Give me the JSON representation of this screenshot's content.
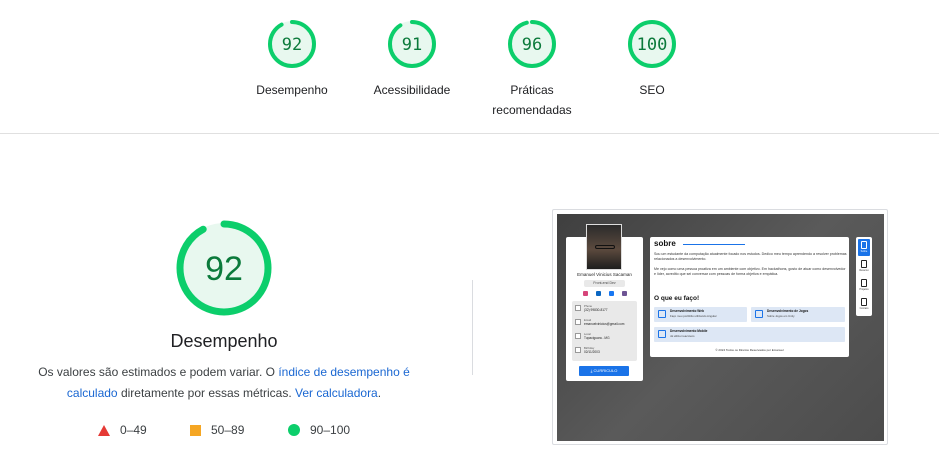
{
  "top_scores": [
    {
      "score": "92",
      "label_line1": "Desempenho",
      "label_line2": ""
    },
    {
      "score": "91",
      "label_line1": "Acessibilidade",
      "label_line2": ""
    },
    {
      "score": "96",
      "label_line1": "Práticas",
      "label_line2": "recomendadas"
    },
    {
      "score": "100",
      "label_line1": "SEO",
      "label_line2": ""
    }
  ],
  "colors": {
    "pass": "#0cce6b",
    "pass_fill": "#e8f8ef",
    "pass_text": "#0b7a3b",
    "average": "#f5a623",
    "fail": "#e53935",
    "link": "#1a67d2"
  },
  "main": {
    "score": "92",
    "score_fraction": 0.92,
    "title": "Desempenho",
    "desc_prefix": "Os valores são estimados e podem variar. O ",
    "desc_link1": "índice de desempenho é calculado",
    "desc_middle": " diretamente por essas métricas. ",
    "desc_link2": "Ver calculadora",
    "desc_suffix": "."
  },
  "legend": [
    {
      "icon": "red-triangle-icon",
      "range": "0–49"
    },
    {
      "icon": "orange-square-icon",
      "range": "50–89"
    },
    {
      "icon": "green-circle-icon",
      "range": "90–100"
    }
  ],
  "screenshot": {
    "profile_name": "Emanuel Vinicius Sacaman",
    "profile_tag": "Front-end Dev",
    "contacts": [
      {
        "title": "Phone",
        "value": "(32) 99830-8177"
      },
      {
        "title": "Email",
        "value": "emanuelvinicius@gmail.com"
      },
      {
        "title": "Local",
        "value": "Tupaciguara - MG"
      },
      {
        "title": "Birthday",
        "value": "02/11/2003"
      }
    ],
    "cv_button": "CURRICULO",
    "about_title": "sobre",
    "about_para1": "Sou um estudante da computação atualmente focado nos estudos. Dedico meu tempo aprendendo a resolver problemas relacionados a desenvolvimento.",
    "about_para2": "Me vejo como uma pessoa proativa em um ambiente com objetivo. Em hackathons, gosto de atuar como desenvolvedor e líder, acredito que sei conversar com pessoas de forma objetiva e empática.",
    "skills_title": "O que eu faço!",
    "cards": [
      {
        "title": "Desenvolvimento Web",
        "desc": "Faço meu portifólio utilizando Angular"
      },
      {
        "title": "Desenvolvimento de Jogos",
        "desc": "Sobre Jogos em Unity"
      },
      {
        "title": "Desenvolvimento Mobile",
        "desc": "Já utilizei react-lens"
      }
    ],
    "footer": "© 2024 Todos os Direitos Reservados por Emanuel",
    "nav": [
      {
        "label": "Sobre"
      },
      {
        "label": "Resumo"
      },
      {
        "label": "Projetos"
      },
      {
        "label": "Contato"
      }
    ]
  }
}
